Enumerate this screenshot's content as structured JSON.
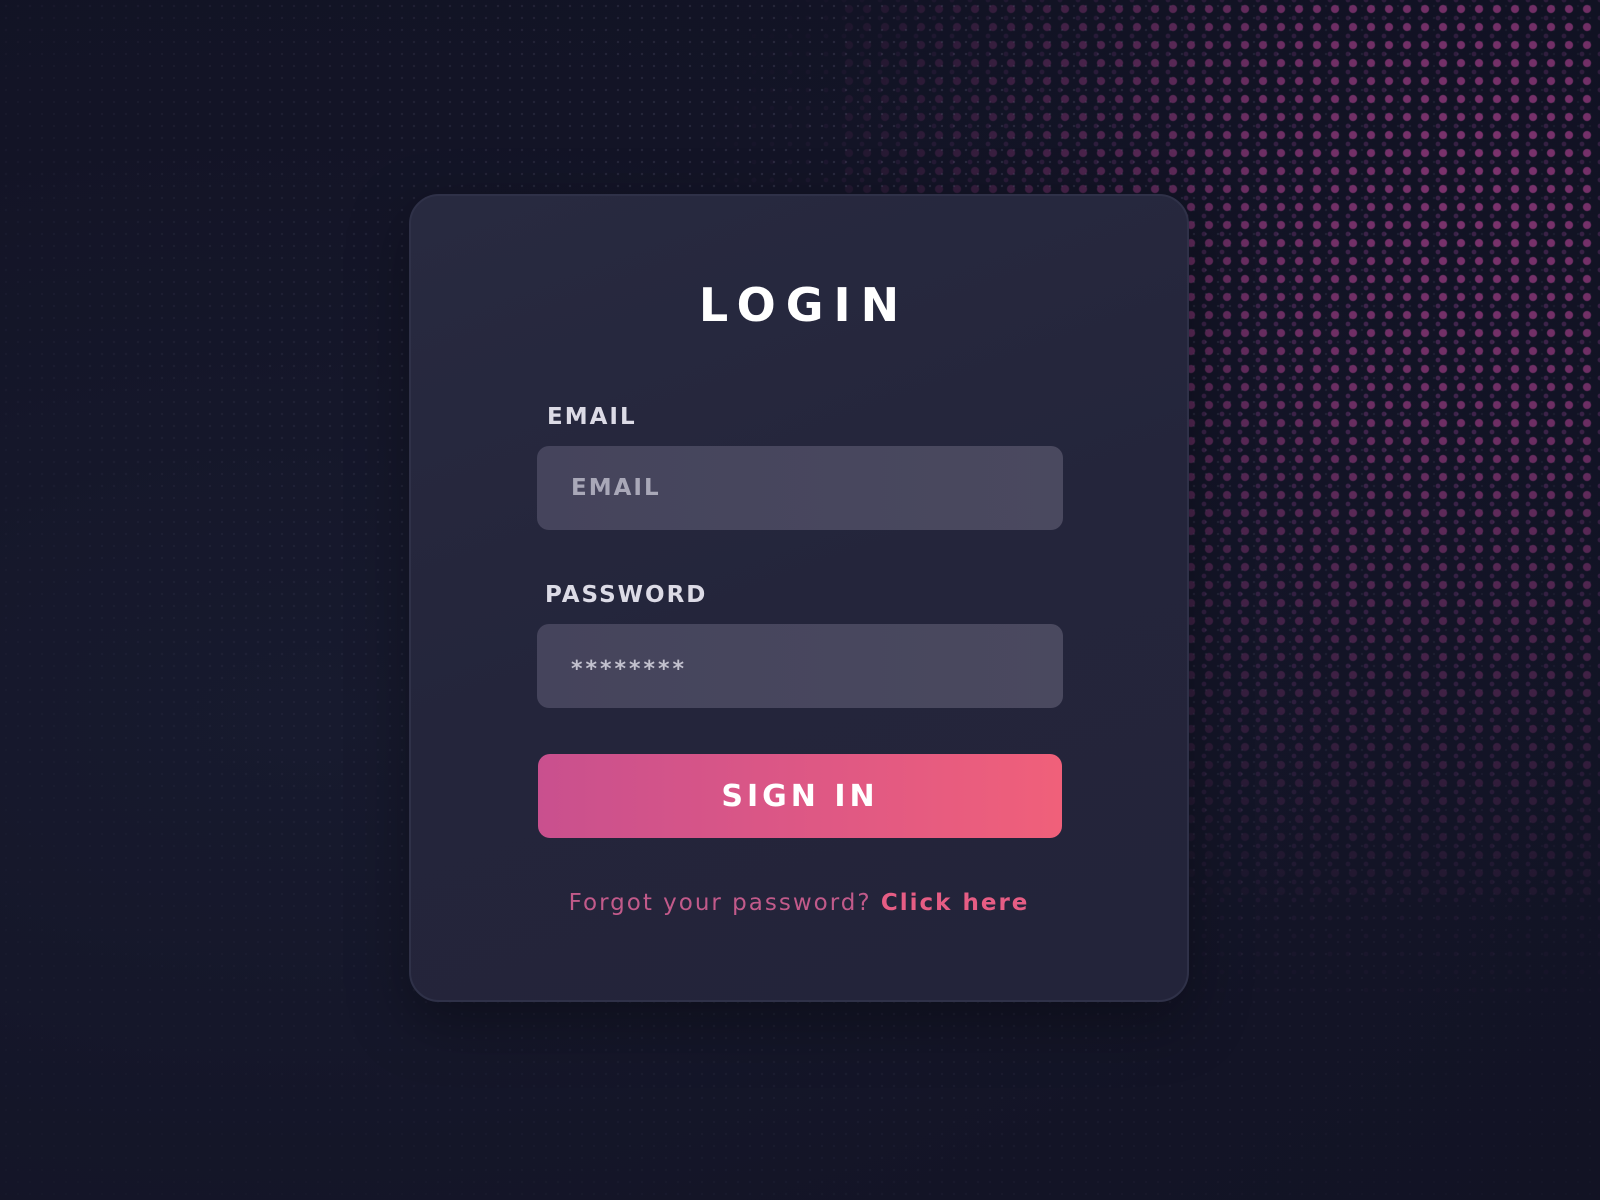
{
  "login": {
    "title": "LOGIN",
    "email_label": "EMAIL",
    "email_placeholder": "EMAIL",
    "password_label": "PASSWORD",
    "password_value": "********",
    "signin_label": "SIGN IN",
    "forgot_text": "Forgot your password?",
    "forgot_link": "Click here"
  },
  "colors": {
    "background": "#14142a",
    "card": "#24253b",
    "input": "#47465d",
    "button_start": "#c9508e",
    "button_end": "#f0607a",
    "accent_link": "#e65d84",
    "halftone": "#a8408c"
  }
}
